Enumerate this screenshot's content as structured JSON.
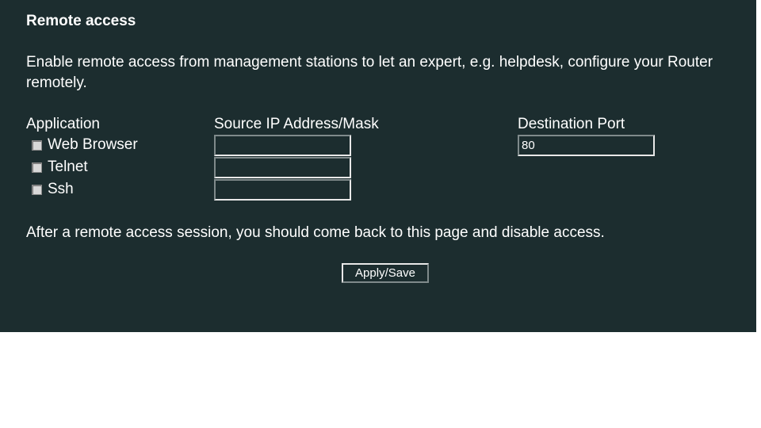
{
  "page": {
    "title": "Remote access",
    "intro": "Enable remote access from management stations to let an expert, e.g. helpdesk, configure your Router remotely.",
    "note": "After a remote access session, you should come back to this page and disable access."
  },
  "table": {
    "headers": {
      "application": "Application",
      "source_ip": "Source IP Address/Mask",
      "destination_port": "Destination Port"
    },
    "rows": [
      {
        "application": "Web Browser",
        "checked": false,
        "source_ip": "",
        "destination_port": "80"
      },
      {
        "application": "Telnet",
        "checked": false,
        "source_ip": ""
      },
      {
        "application": "Ssh",
        "checked": false,
        "source_ip": ""
      }
    ]
  },
  "actions": {
    "apply_label": "Apply/Save"
  },
  "colors": {
    "panel_background": "#1c2d2f",
    "text": "#ffffff",
    "page_background": "#ffffff"
  }
}
